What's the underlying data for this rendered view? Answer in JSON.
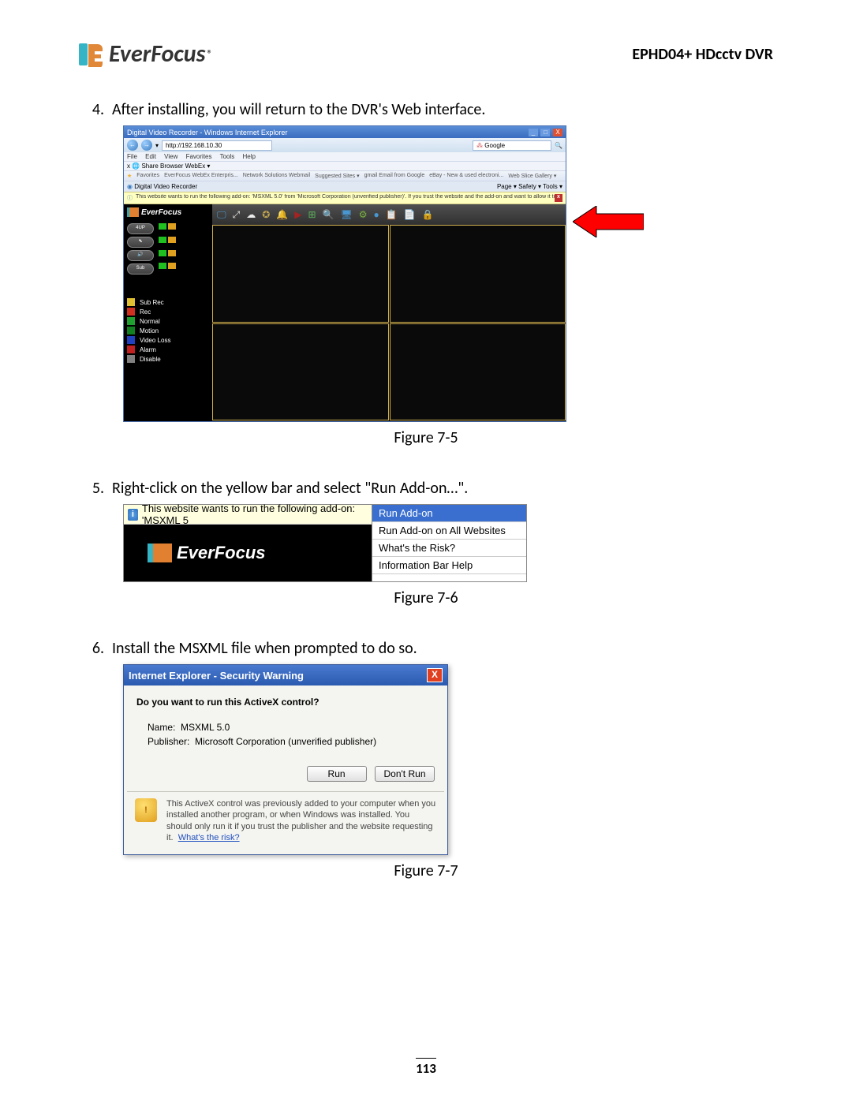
{
  "header": {
    "brand": "EverFocus",
    "product": "EPHD04+  HDcctv DVR"
  },
  "steps": {
    "s4_num": "4.",
    "s4_text": "After installing, you will return to the DVR's Web interface.",
    "s5_num": "5.",
    "s5_text": "Right-click on the yellow bar and select \"Run Add-on…\".",
    "s6_num": "6.",
    "s6_text": "Install the MSXML file when prompted to do so."
  },
  "captions": {
    "fig75": "Figure 7-5",
    "fig76": "Figure 7-6",
    "fig77": "Figure 7-7"
  },
  "ie": {
    "title": "Digital Video Recorder - Windows Internet Explorer",
    "url": "http://192.168.10.30",
    "search": "Google",
    "menu_file": "File",
    "menu_edit": "Edit",
    "menu_view": "View",
    "menu_fav": "Favorites",
    "menu_tools": "Tools",
    "menu_help": "Help",
    "share_x": "x",
    "share_label": "Share Browser   WebEx  ▾",
    "fav_label": "Favorites",
    "fav1": "EverFocus WebEx Enterpris...",
    "fav2": "Network Solutions Webmail",
    "fav3": "Suggested Sites ▾",
    "fav4": "gmail Email from Google",
    "fav5": "eBay - New & used electroni...",
    "fav6": "Web Slice Gallery ▾",
    "tab": "Digital Video Recorder",
    "tab_tools": "Page ▾   Safety ▾   Tools ▾",
    "infobar": "This website wants to run the following add-on: 'MSXML 5.0' from 'Microsoft Corporation (unverified publisher)'. If you trust the website and the add-on and want to allow it to run, click here..."
  },
  "dvr": {
    "brand": "EverFocus",
    "btn_4up": "4UP",
    "btn_ptz": "⬉",
    "btn_audio": "🔊",
    "btn_sub": "Sub",
    "leg_subrec": "Sub Rec",
    "leg_rec": "Rec",
    "leg_normal": "Normal",
    "leg_motion": "Motion",
    "leg_videoloss": "Video Loss",
    "leg_alarm": "Alarm",
    "leg_disable": "Disable"
  },
  "fig76": {
    "infobar": "This website wants to run the following add-on: 'MSXML 5",
    "menu_run": "Run Add-on",
    "menu_runall": "Run Add-on on All Websites",
    "menu_whats": "What's the Risk?",
    "menu_help": "Information Bar Help",
    "brand": "EverFocus"
  },
  "dialog": {
    "title": "Internet Explorer - Security Warning",
    "question": "Do you want to run this ActiveX control?",
    "name_label": "Name:",
    "name_val": "MSXML 5.0",
    "pub_label": "Publisher:",
    "pub_val": "Microsoft Corporation (unverified publisher)",
    "btn_run": "Run",
    "btn_dont": "Don't Run",
    "footer": "This ActiveX control was previously added to your computer when you installed another program, or when Windows was installed. You should only run it if you trust the publisher and the website requesting it.",
    "footer_link": "What's the risk?"
  },
  "page_number": "113"
}
